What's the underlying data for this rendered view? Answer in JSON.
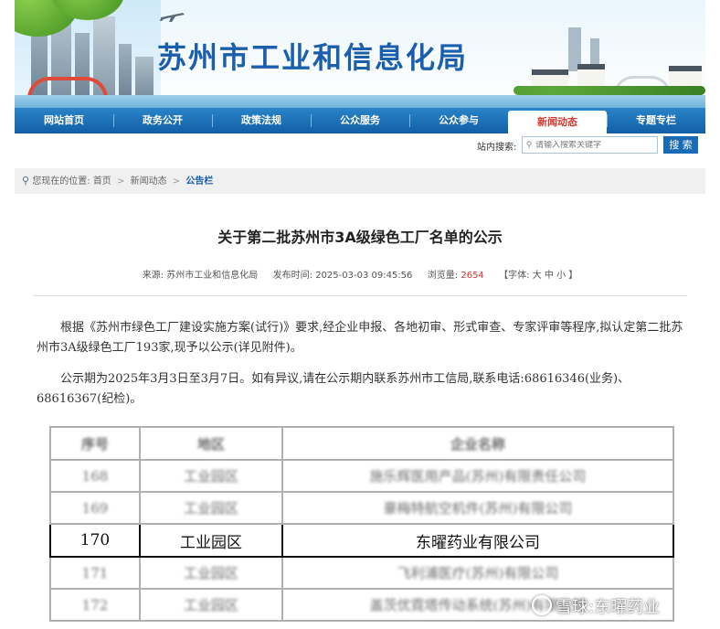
{
  "header": {
    "site_title": "苏州市工业和信息化局"
  },
  "nav": {
    "items": [
      {
        "label": "网站首页"
      },
      {
        "label": "政务公开"
      },
      {
        "label": "政策法规"
      },
      {
        "label": "公众服务"
      },
      {
        "label": "公众参与"
      },
      {
        "label": "新闻动态",
        "active": true
      },
      {
        "label": "专题专栏"
      }
    ]
  },
  "search": {
    "label": "站内搜索:",
    "placeholder": "请输入搜索关键字",
    "button": "搜 索"
  },
  "breadcrumb": {
    "prefix": "您现在的位置:",
    "home": "首页",
    "level2": "新闻动态",
    "current": "公告栏",
    "sep": ">"
  },
  "article": {
    "title": "关于第二批苏州市3A级绿色工厂名单的公示",
    "source_label": "来源:",
    "source": "苏州市工业和信息化局",
    "time_label": "发布时间:",
    "time": "2025-03-03 09:45:56",
    "views_label": "浏览量:",
    "views": "2654",
    "font_label": "【字体:",
    "font_large": "大",
    "font_medium": "中",
    "font_small": "小",
    "font_close": "】",
    "para1": "根据《苏州市绿色工厂建设实施方案(试行)》要求,经企业申报、各地初审、形式审查、专家评审等程序,拟认定第二批苏州市3A级绿色工厂193家,现予以公示(详见附件)。",
    "para2": "公示期为2025年3月3日至3月7日。如有异议,请在公示期内联系苏州市工信局,联系电话:68616346(业务)、68616367(纪检)。"
  },
  "table": {
    "headers": [
      "序号",
      "地区",
      "企业名称"
    ],
    "rows": [
      [
        "168",
        "工业园区",
        "施乐辉医用产品(苏州)有限责任公司"
      ],
      [
        "169",
        "工业园区",
        "豪梅特航空机件(苏州)有限公司"
      ],
      [
        "170",
        "工业园区",
        "东曜药业有限公司"
      ],
      [
        "171",
        "工业园区",
        "飞利浦医疗(苏州)有限公司"
      ],
      [
        "172",
        "工业园区",
        "盖茨优霓塔传动系统(苏州)有限公司"
      ]
    ],
    "highlighted_row": 2
  },
  "watermark": {
    "text": "雪球:东曜药业"
  },
  "colors": {
    "brand_blue": "#1a5fae",
    "nav_blue": "#125fa6",
    "accent_red": "#d6362c"
  },
  "icons": {
    "breadcrumb": "location-pin-icon",
    "search": "magnifier-icon",
    "banner": "airplane-icon"
  }
}
